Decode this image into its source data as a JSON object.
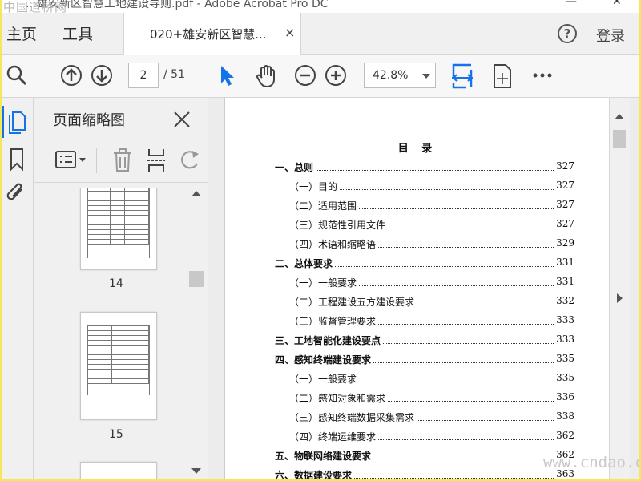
{
  "window": {
    "watermark": "中国道桥网",
    "title": "…雄安新区智慧工地建设导则.pdf - Adobe Acrobat Pro DC",
    "minimize": "—",
    "close": "✕"
  },
  "tabs": {
    "home": "主页",
    "tools": "工具",
    "document": "020+雄安新区智慧...",
    "close": "×",
    "help": "?",
    "login": "登录"
  },
  "toolbar": {
    "page_current": "2",
    "page_total": "/ 51",
    "zoom": "42.8%"
  },
  "panel": {
    "title": "页面缩略图",
    "thumbnails": [
      {
        "label": "14"
      },
      {
        "label": "15"
      }
    ]
  },
  "document": {
    "heading": "目 录",
    "toc": [
      {
        "text": "一、总则",
        "page": "327",
        "level": 1
      },
      {
        "text": "（一）目的",
        "page": "327",
        "level": 2
      },
      {
        "text": "（二）适用范围",
        "page": "327",
        "level": 2
      },
      {
        "text": "（三）规范性引用文件",
        "page": "327",
        "level": 2
      },
      {
        "text": "（四）术语和缩略语",
        "page": "329",
        "level": 2
      },
      {
        "text": "二、总体要求",
        "page": "331",
        "level": 1
      },
      {
        "text": "（一）一般要求",
        "page": "331",
        "level": 2
      },
      {
        "text": "（二）工程建设五方建设要求",
        "page": "332",
        "level": 2
      },
      {
        "text": "（三）监督管理要求",
        "page": "333",
        "level": 2
      },
      {
        "text": "三、工地智能化建设要点",
        "page": "333",
        "level": 1
      },
      {
        "text": "四、感知终端建设要求",
        "page": "335",
        "level": 1
      },
      {
        "text": "（一）一般要求",
        "page": "335",
        "level": 2
      },
      {
        "text": "（二）感知对象和需求",
        "page": "336",
        "level": 2
      },
      {
        "text": "（三）感知终端数据采集需求",
        "page": "338",
        "level": 2
      },
      {
        "text": "（四）终端运维要求",
        "page": "362",
        "level": 2
      },
      {
        "text": "五、物联网络建设要求",
        "page": "362",
        "level": 1
      },
      {
        "text": "六、数据建设要求",
        "page": "363",
        "level": 1
      }
    ],
    "site_watermark": "www.cndao.com"
  },
  "colors": {
    "accent": "#1473e6",
    "frame": "#f4e85a"
  }
}
